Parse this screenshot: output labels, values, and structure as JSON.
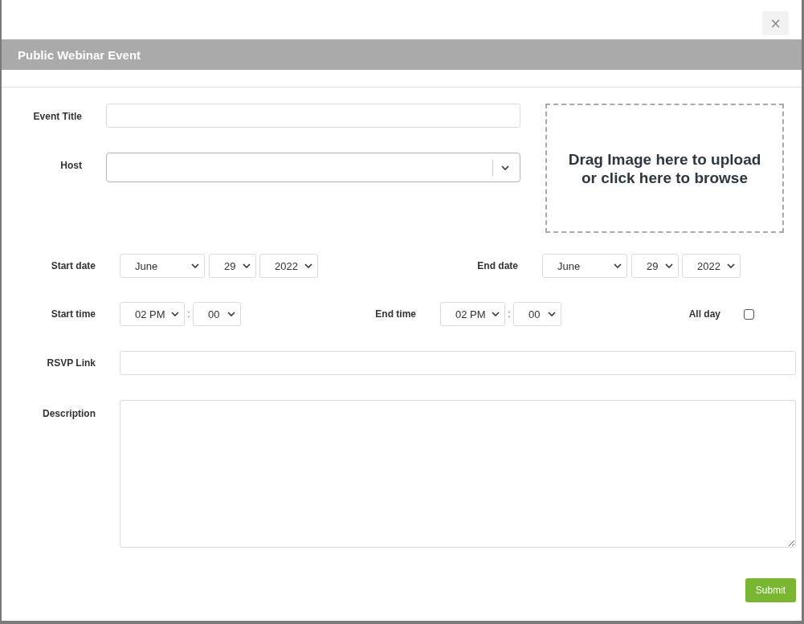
{
  "dialog": {
    "close_button": "×",
    "title": "Public Webinar Event"
  },
  "fields": [
    {
      "kind": "text",
      "label": "Event Title"
    },
    {
      "kind": "dropdown",
      "label": "Host"
    }
  ],
  "upload_area": {
    "text": "Drag Image here to upload or click here to browse"
  },
  "start_date": {
    "label": "Start date",
    "month": "June",
    "day": "29",
    "year": "2022"
  },
  "end_date": {
    "label": "End date",
    "month": "June",
    "day": "29",
    "year": "2022"
  },
  "start_time": {
    "label": "Start time",
    "hour": "02 PM",
    "separator": ":",
    "minute": "00"
  },
  "end_time": {
    "label": "End time",
    "hour": "02 PM",
    "separator": ":",
    "minute": "00"
  },
  "all_day": {
    "label": "All day",
    "checked": false
  },
  "rsvp_link": {
    "label": "RSVP Link"
  },
  "description": {
    "label": "Description"
  },
  "submit_button": "Submit"
}
